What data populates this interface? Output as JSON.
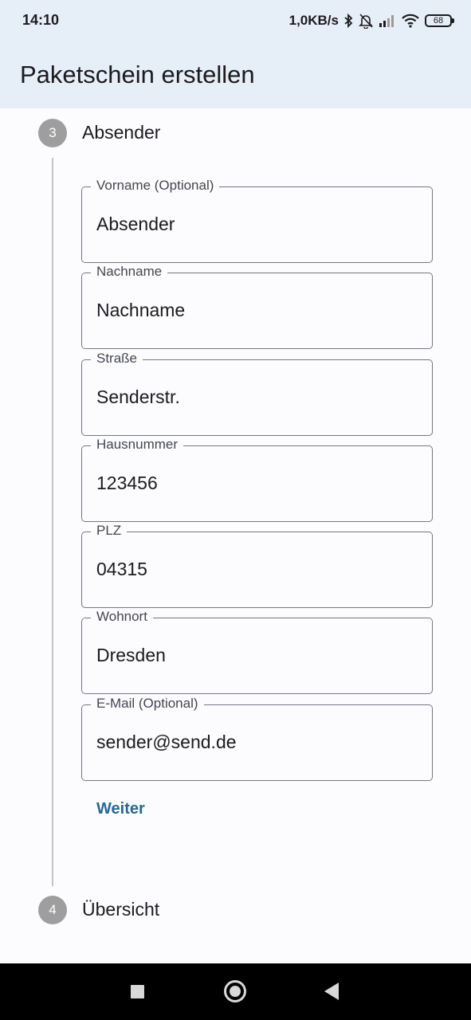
{
  "status_bar": {
    "time": "14:10",
    "network_speed": "1,0KB/s",
    "battery_level": "68",
    "icons": [
      "bluetooth-icon",
      "notifications-muted-icon",
      "signal-icon",
      "wifi-icon",
      "battery-icon"
    ]
  },
  "app_bar": {
    "title": "Paketschein erstellen"
  },
  "stepper": {
    "current_step": {
      "number": "3",
      "title": "Absender"
    },
    "next_step": {
      "number": "4",
      "title": "Übersicht"
    }
  },
  "form": {
    "fields": [
      {
        "label": "Vorname (Optional)",
        "value": "Absender"
      },
      {
        "label": "Nachname",
        "value": "Nachname"
      },
      {
        "label": "Straße",
        "value": "Senderstr."
      },
      {
        "label": "Hausnummer",
        "value": "123456"
      },
      {
        "label": "PLZ",
        "value": "04315"
      },
      {
        "label": "Wohnort",
        "value": "Dresden"
      },
      {
        "label": "E-Mail (Optional)",
        "value": "sender@send.de"
      }
    ],
    "continue_label": "Weiter"
  },
  "colors": {
    "app_bar_background": "#e6eef7",
    "page_background": "#fcfcff",
    "step_circle": "#9e9e9e",
    "accent": "#2a6690",
    "field_border": "#75777f"
  }
}
